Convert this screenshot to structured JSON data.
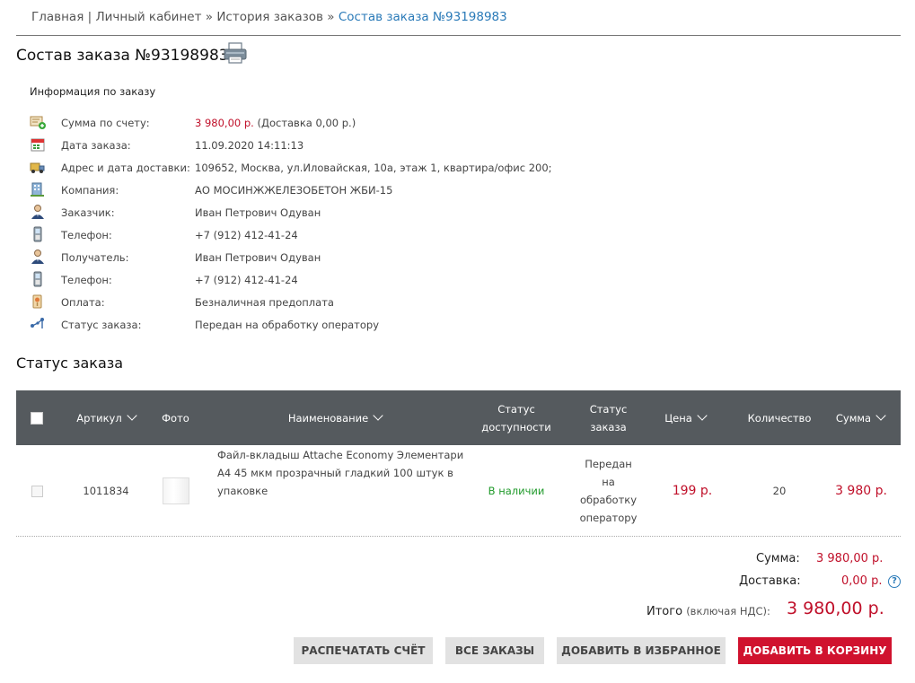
{
  "breadcrumb": {
    "home": "Главная",
    "cabinet": "Личный кабинет",
    "history": "История заказов",
    "current": "Состав заказа №93198983",
    "sep_pipe": "|",
    "sep_arrow": "»"
  },
  "title": "Состав заказа №93198983",
  "info": {
    "heading": "Информация по заказу",
    "rows": [
      {
        "icon": "invoice-icon",
        "label": "Сумма по счету:",
        "value_red": "3 980,00 р.",
        "value": " (Доставка 0,00 р.)"
      },
      {
        "icon": "calendar-icon",
        "label": "Дата заказа:",
        "value": "11.09.2020 14:11:13"
      },
      {
        "icon": "truck-icon",
        "label": "Адрес и дата доставки:",
        "value": "109652, Москва, ул.Иловайская, 10а, этаж 1, квартира/офис 200;"
      },
      {
        "icon": "building-icon",
        "label": "Компания:",
        "value": "АО МОСИНЖЖЕЛЕЗОБЕТОН ЖБИ-15"
      },
      {
        "icon": "person-icon",
        "label": "Заказчик:",
        "value": "Иван Петрович Одуван"
      },
      {
        "icon": "phone-icon",
        "label": "Телефон:",
        "value": "+7 (912) 412-41-24"
      },
      {
        "icon": "person-icon",
        "label": "Получатель:",
        "value": "Иван Петрович Одуван"
      },
      {
        "icon": "phone-icon",
        "label": "Телефон:",
        "value": "+7 (912) 412-41-24"
      },
      {
        "icon": "payment-icon",
        "label": "Оплата:",
        "value": "Безналичная предоплата"
      },
      {
        "icon": "status-icon",
        "label": "Статус заказа:",
        "value": "Передан на обработку оператору"
      }
    ]
  },
  "status_title": "Статус заказа",
  "table": {
    "headers": {
      "article": "Артикул",
      "photo": "Фото",
      "name": "Наименование",
      "availability_1": "Статус",
      "availability_2": "доступности",
      "order_status_1": "Статус",
      "order_status_2": "заказа",
      "price": "Цена",
      "quantity": "Количество",
      "sum": "Сумма"
    },
    "row": {
      "article": "1011834",
      "name_1": "Файл-вкладыш Attache Economy Элементари",
      "name_2": "А4 45 мкм прозрачный гладкий 100 штук в",
      "name_3": "упаковке",
      "availability": "В наличии",
      "status_1": "Передан",
      "status_2": "на",
      "status_3": "обработку",
      "status_4": "оператору",
      "price": "199 р.",
      "quantity": "20",
      "sum": "3 980 р."
    }
  },
  "totals": {
    "sum_label": "Сумма:",
    "sum_value": "3 980,00 р.",
    "delivery_label": "Доставка:",
    "delivery_value": "0,00 р.",
    "help": "?",
    "total_label": "Итого",
    "total_note": "(включая НДС):",
    "total_value": "3 980,00 р."
  },
  "buttons": {
    "print": "Распечатать счёт",
    "all_orders": "Все заказы",
    "favorite": "Добавить в избранное",
    "cart": "Добавить в корзину"
  },
  "colors": {
    "accent_red": "#d0122e",
    "link_blue": "#2a7ab8",
    "header_gray": "#555a5e",
    "available_green": "#1f9a2a"
  }
}
